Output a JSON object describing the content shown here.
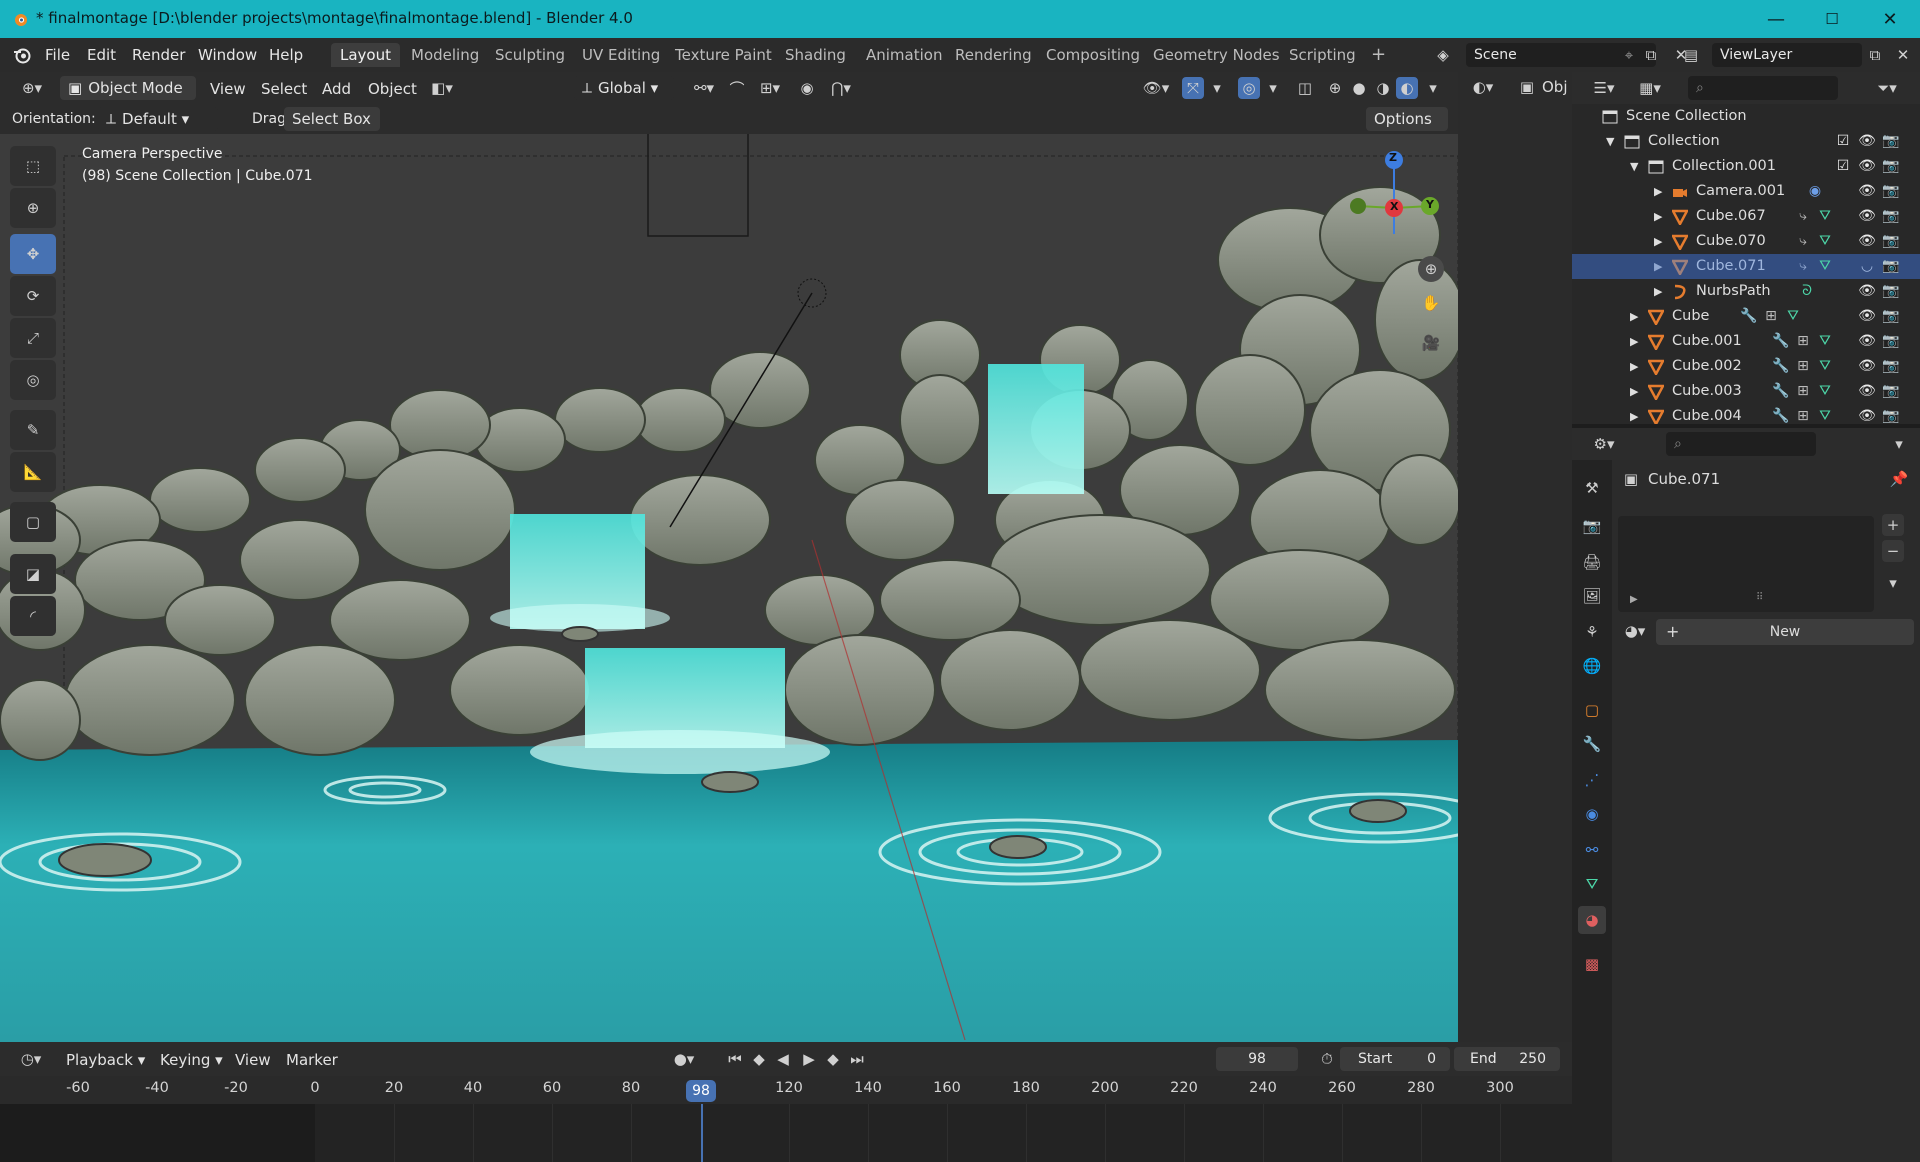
{
  "window": {
    "title": "* finalmontage [D:\\blender projects\\montage\\finalmontage.blend] - Blender 4.0",
    "minimize": "—",
    "maximize": "☐",
    "close": "✕"
  },
  "menu": [
    "File",
    "Edit",
    "Render",
    "Window",
    "Help"
  ],
  "workspaces": [
    "Layout",
    "Modeling",
    "Sculpting",
    "UV Editing",
    "Texture Paint",
    "Shading",
    "Animation",
    "Rendering",
    "Compositing",
    "Geometry Nodes",
    "Scripting"
  ],
  "workspace_add": "+",
  "scene": {
    "name": "Scene",
    "view_layer": "ViewLayer"
  },
  "viewport": {
    "mode": "Object Mode",
    "menus": [
      "View",
      "Select",
      "Add",
      "Object"
    ],
    "transform": "Global",
    "orientation_label": "Orientation:",
    "orientation": "Default",
    "drag_label": "Drag:",
    "drag": "Select Box",
    "options": "Options",
    "overlay_title": "Camera Perspective",
    "overlay_sub": "(98) Scene Collection | Cube.071",
    "gizmo": {
      "z": "Z",
      "x": "X",
      "y": "Y"
    }
  },
  "outliner": {
    "header_label": "Obj",
    "rows": [
      {
        "label": "Scene Collection",
        "indent": 0
      },
      {
        "label": "Collection",
        "indent": 1
      },
      {
        "label": "Collection.001",
        "indent": 2
      },
      {
        "label": "Camera.001",
        "indent": 3
      },
      {
        "label": "Cube.067",
        "indent": 3
      },
      {
        "label": "Cube.070",
        "indent": 3
      },
      {
        "label": "Cube.071",
        "indent": 3,
        "selected": true
      },
      {
        "label": "NurbsPath",
        "indent": 3
      },
      {
        "label": "Cube",
        "indent": 2
      },
      {
        "label": "Cube.001",
        "indent": 2
      },
      {
        "label": "Cube.002",
        "indent": 2
      },
      {
        "label": "Cube.003",
        "indent": 2
      },
      {
        "label": "Cube.004",
        "indent": 2
      }
    ]
  },
  "properties": {
    "object_name": "Cube.071",
    "new_button": "New",
    "plus": "+",
    "minus": "−"
  },
  "timeline": {
    "menus": [
      "Playback",
      "Keying",
      "View",
      "Marker"
    ],
    "current_frame": "98",
    "start_label": "Start",
    "start": "0",
    "end_label": "End",
    "end": "250",
    "ticks": [
      "-60",
      "-40",
      "-20",
      "0",
      "20",
      "40",
      "60",
      "80",
      "120",
      "140",
      "160",
      "180",
      "200",
      "220",
      "240",
      "260",
      "280",
      "300"
    ],
    "playhead": "98"
  },
  "colors": {
    "titlebar": "#19b4c1",
    "accent_blue": "#4772b3",
    "water": "#2fb8bf",
    "rock": "#8e9488",
    "selected_row": "#334d80"
  }
}
